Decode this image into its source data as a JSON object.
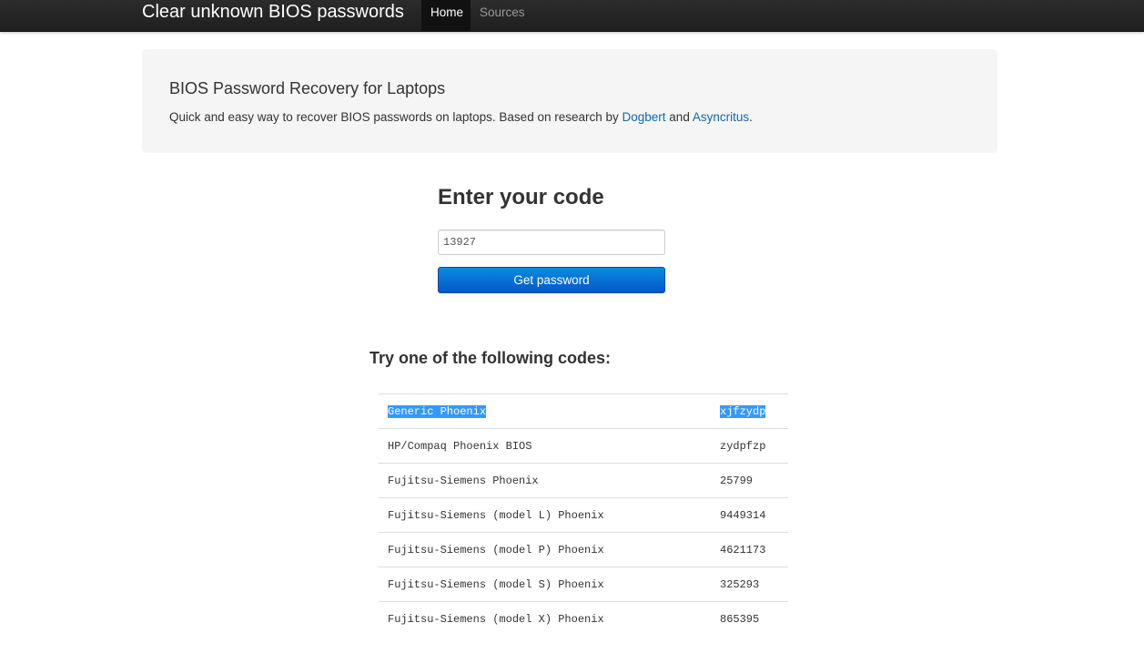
{
  "navbar": {
    "brand": "Clear unknown BIOS passwords",
    "items": [
      {
        "label": "Home"
      },
      {
        "label": "Sources"
      }
    ]
  },
  "hero": {
    "title": "BIOS Password Recovery for Laptops",
    "text_prefix": "Quick and easy way to recover BIOS passwords on laptops. Based on research by ",
    "link1": "Dogbert",
    "text_mid": " and ",
    "link2": "Asyncritus",
    "text_suffix": "."
  },
  "form": {
    "title": "Enter your code",
    "input_value": "13927",
    "button_label": "Get password"
  },
  "results": {
    "title": "Try one of the following codes:",
    "rows": [
      {
        "bios": "Generic Phoenix",
        "password": "xjfzydp"
      },
      {
        "bios": "HP/Compaq Phoenix BIOS",
        "password": "zydpfzp"
      },
      {
        "bios": "Fujitsu-Siemens Phoenix",
        "password": "25799"
      },
      {
        "bios": "Fujitsu-Siemens (model L) Phoenix",
        "password": "9449314"
      },
      {
        "bios": "Fujitsu-Siemens (model P) Phoenix",
        "password": "4621173"
      },
      {
        "bios": "Fujitsu-Siemens (model S) Phoenix",
        "password": "325293"
      },
      {
        "bios": "Fujitsu-Siemens (model X) Phoenix",
        "password": "865395"
      }
    ]
  },
  "colors": {
    "navbar": "#222222",
    "link": "#0f68b0",
    "button": "#0a7ad8",
    "selection": "#3399ff"
  }
}
